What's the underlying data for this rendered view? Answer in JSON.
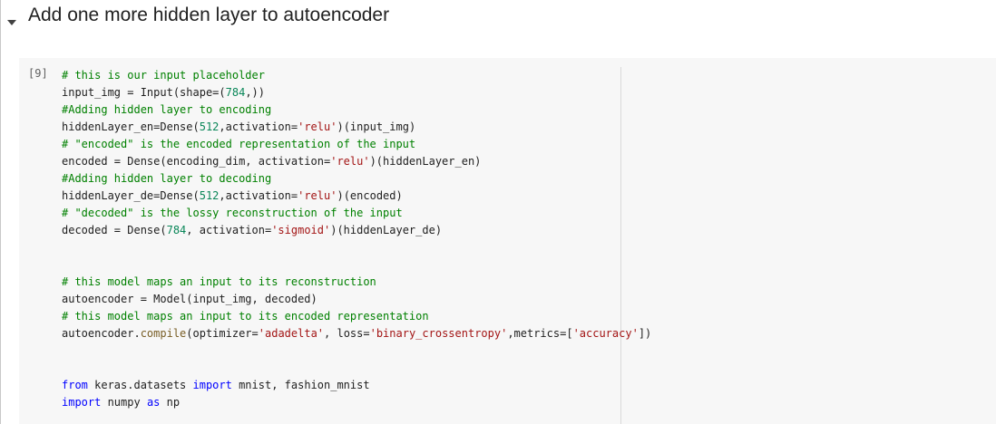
{
  "section": {
    "title": "Add one more hidden layer to autoencoder",
    "toggle_icon": "caret-down-icon"
  },
  "cell": {
    "execution_count": "[9]",
    "lines": [
      [
        {
          "t": "# this is our input placeholder",
          "k": "comment"
        }
      ],
      [
        {
          "t": "input_img = Input(shape=(",
          "k": "plain"
        },
        {
          "t": "784",
          "k": "number"
        },
        {
          "t": ",))",
          "k": "plain"
        }
      ],
      [
        {
          "t": "#Adding hidden layer to encoding",
          "k": "comment"
        }
      ],
      [
        {
          "t": "hiddenLayer_en=Dense(",
          "k": "plain"
        },
        {
          "t": "512",
          "k": "number"
        },
        {
          "t": ",activation=",
          "k": "plain"
        },
        {
          "t": "'relu'",
          "k": "string"
        },
        {
          "t": ")(input_img)",
          "k": "plain"
        }
      ],
      [
        {
          "t": "# \"encoded\" is the encoded representation of the input",
          "k": "comment"
        }
      ],
      [
        {
          "t": "encoded = Dense(encoding_dim, activation=",
          "k": "plain"
        },
        {
          "t": "'relu'",
          "k": "string"
        },
        {
          "t": ")(hiddenLayer_en)",
          "k": "plain"
        }
      ],
      [
        {
          "t": "#Adding hidden layer to decoding",
          "k": "comment"
        }
      ],
      [
        {
          "t": "hiddenLayer_de=Dense(",
          "k": "plain"
        },
        {
          "t": "512",
          "k": "number"
        },
        {
          "t": ",activation=",
          "k": "plain"
        },
        {
          "t": "'relu'",
          "k": "string"
        },
        {
          "t": ")(encoded)",
          "k": "plain"
        }
      ],
      [
        {
          "t": "# \"decoded\" is the lossy reconstruction of the input",
          "k": "comment"
        }
      ],
      [
        {
          "t": "decoded = Dense(",
          "k": "plain"
        },
        {
          "t": "784",
          "k": "number"
        },
        {
          "t": ", activation=",
          "k": "plain"
        },
        {
          "t": "'sigmoid'",
          "k": "string"
        },
        {
          "t": ")(hiddenLayer_de)",
          "k": "plain"
        }
      ],
      [],
      [],
      [
        {
          "t": "# this model maps an input to its reconstruction",
          "k": "comment"
        }
      ],
      [
        {
          "t": "autoencoder = Model(input_img, decoded)",
          "k": "plain"
        }
      ],
      [
        {
          "t": "# this model maps an input to its encoded representation",
          "k": "comment"
        }
      ],
      [
        {
          "t": "autoencoder.",
          "k": "plain"
        },
        {
          "t": "compile",
          "k": "builtin"
        },
        {
          "t": "(optimizer=",
          "k": "plain"
        },
        {
          "t": "'adadelta'",
          "k": "string"
        },
        {
          "t": ", loss=",
          "k": "plain"
        },
        {
          "t": "'binary_crossentropy'",
          "k": "string"
        },
        {
          "t": ",metrics=[",
          "k": "plain"
        },
        {
          "t": "'accuracy'",
          "k": "string"
        },
        {
          "t": "])",
          "k": "plain"
        }
      ],
      [],
      [],
      [
        {
          "t": "from",
          "k": "keyword"
        },
        {
          "t": " keras.datasets ",
          "k": "plain"
        },
        {
          "t": "import",
          "k": "keyword"
        },
        {
          "t": " mnist, fashion_mnist",
          "k": "plain"
        }
      ],
      [
        {
          "t": "import",
          "k": "keyword"
        },
        {
          "t": " numpy ",
          "k": "plain"
        },
        {
          "t": "as",
          "k": "keyword"
        },
        {
          "t": " np",
          "k": "plain"
        }
      ]
    ]
  },
  "colors": {
    "comment": "#008000",
    "string": "#a31515",
    "number": "#098658",
    "keyword": "#0000ff",
    "builtin": "#795e26",
    "plain": "#212121"
  }
}
